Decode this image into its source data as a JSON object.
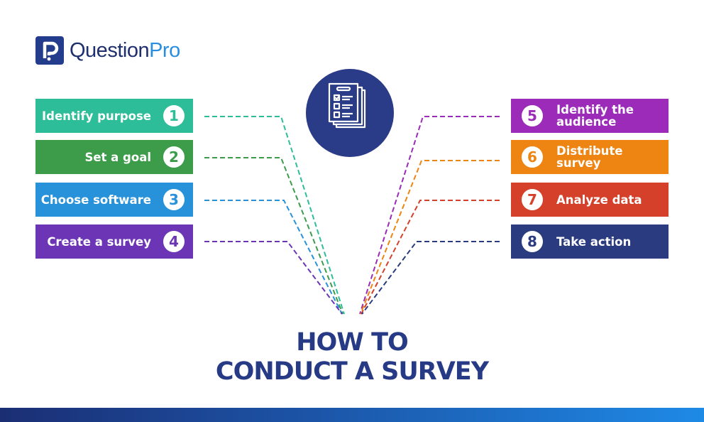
{
  "brand": {
    "name_part1": "Question",
    "name_part2": "Pro",
    "logo_icon": "question-mark-logo-icon"
  },
  "center_icon": "survey-checklist-icon",
  "title": {
    "line1": "HOW TO",
    "line2": "CONDUCT A SURVEY"
  },
  "steps_left": [
    {
      "number": "1",
      "label": "Identify purpose",
      "color": "#2dbd99"
    },
    {
      "number": "2",
      "label": "Set a goal",
      "color": "#3d9c4a"
    },
    {
      "number": "3",
      "label": "Choose software",
      "color": "#2792d9"
    },
    {
      "number": "4",
      "label": "Create a survey",
      "color": "#6c35b5"
    }
  ],
  "steps_right": [
    {
      "number": "5",
      "label": "Identify the audience",
      "color": "#9b2bb8"
    },
    {
      "number": "6",
      "label": "Distribute survey",
      "color": "#ee8411"
    },
    {
      "number": "7",
      "label": "Analyze data",
      "color": "#d5402a"
    },
    {
      "number": "8",
      "label": "Take action",
      "color": "#2a3b7f"
    }
  ],
  "colors": {
    "brand_dark": "#233d8c",
    "brand_light": "#2a8ee0",
    "title": "#273a86"
  }
}
